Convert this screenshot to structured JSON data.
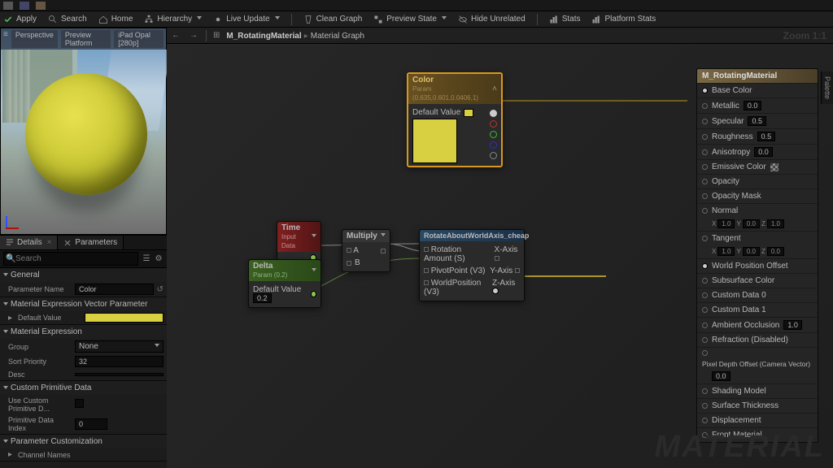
{
  "toolbar": {
    "apply": "Apply",
    "search": "Search",
    "home": "Home",
    "hierarchy": "Hierarchy",
    "live_update": "Live Update",
    "clean_graph": "Clean Graph",
    "preview_state": "Preview State",
    "hide_unrelated": "Hide Unrelated",
    "stats": "Stats",
    "platform_stats": "Platform Stats"
  },
  "viewport": {
    "view": "Perspective",
    "platform": "Preview Platform",
    "other": "iPad Opal [280p]"
  },
  "tabs": {
    "details": "Details",
    "parameters": "Parameters"
  },
  "search": {
    "placeholder": "Search"
  },
  "details": {
    "sec_general": "General",
    "param_name_lbl": "Parameter Name",
    "param_name_val": "Color",
    "sec_mevp": "Material Expression Vector Parameter",
    "default_value_lbl": "Default Value",
    "sec_me": "Material Expression",
    "group_lbl": "Group",
    "group_val": "None",
    "sort_lbl": "Sort Priority",
    "sort_val": "32",
    "desc_lbl": "Desc",
    "sec_cpd": "Custom Primitive Data",
    "usecpd_lbl": "Use Custom Primitive D...",
    "pdi_lbl": "Primitive Data Index",
    "pdi_val": "0",
    "sec_pc": "Parameter Customization",
    "chan_lbl": "Channel Names"
  },
  "breadcrumb": {
    "root": "M_RotatingMaterial",
    "leaf": "Material Graph"
  },
  "zoom": "Zoom 1:1",
  "watermark": "MATERIAL",
  "palette": "Palette",
  "nodes": {
    "color": {
      "title": "Color",
      "sub": "Param (0.635,0.601,0.0406,1)",
      "dv_lbl": "Default Value"
    },
    "time": {
      "title": "Time",
      "sub": "Input Data"
    },
    "delta": {
      "title": "Delta",
      "sub": "Param (0.2)",
      "dv_lbl": "Default Value",
      "dv_val": "0.2"
    },
    "multiply": {
      "title": "Multiply",
      "a": "A",
      "b": "B"
    },
    "rotate": {
      "title": "RotateAboutWorldAxis_cheap",
      "p1": "Rotation Amount (S)",
      "p2": "PivotPoint (V3)",
      "p3": "WorldPosition (V3)",
      "o1": "X-Axis",
      "o2": "Y-Axis",
      "o3": "Z-Axis"
    }
  },
  "result": {
    "title": "M_RotatingMaterial",
    "base_color": "Base Color",
    "metallic": "Metallic",
    "metallic_v": "0.0",
    "specular": "Specular",
    "specular_v": "0.5",
    "roughness": "Roughness",
    "roughness_v": "0.5",
    "anisotropy": "Anisotropy",
    "anisotropy_v": "0.0",
    "emissive": "Emissive Color",
    "opacity": "Opacity",
    "opacity_mask": "Opacity Mask",
    "normal": "Normal",
    "tangent": "Tangent",
    "nx": "1.0",
    "ny": "0.0",
    "nz": "1.0",
    "tx": "1.0",
    "ty": "0.0",
    "tz": "0.0",
    "wpo": "World Position Offset",
    "sub": "Subsurface Color",
    "cd0": "Custom Data 0",
    "cd1": "Custom Data 1",
    "ao": "Ambient Occlusion",
    "ao_v": "1.0",
    "refraction": "Refraction (Disabled)",
    "pdo": "Pixel Depth Offset (Camera Vector)",
    "pdo_v": "0.0",
    "shading": "Shading Model",
    "thickness": "Surface Thickness",
    "displacement": "Displacement",
    "front": "Front Material"
  }
}
